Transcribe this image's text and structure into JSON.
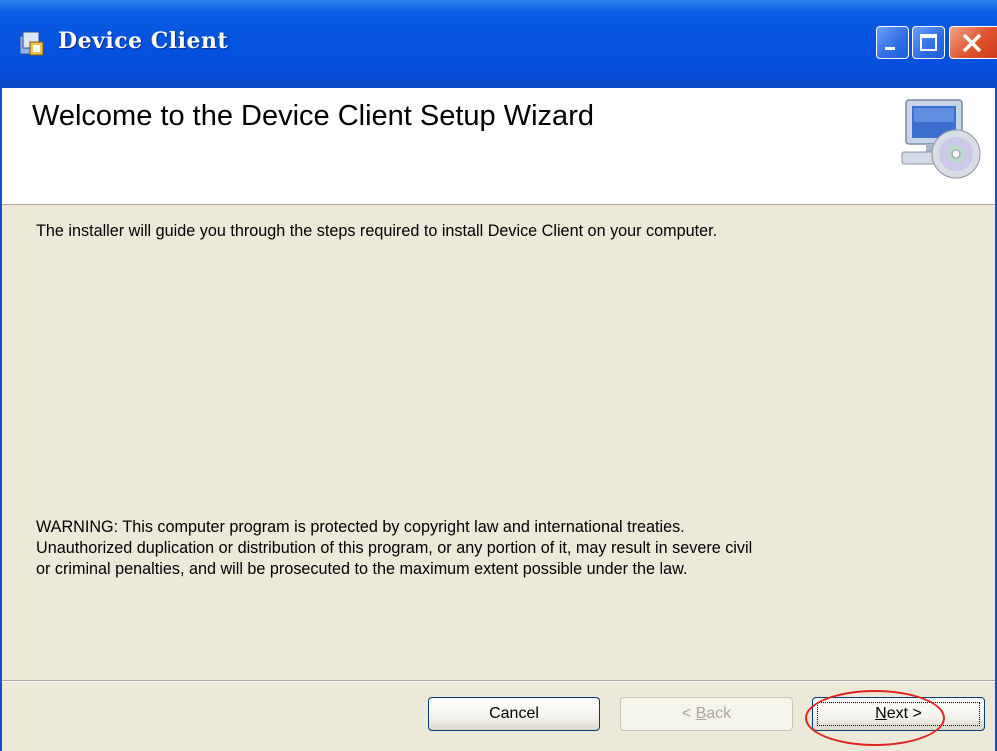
{
  "window": {
    "title": "Device Client",
    "controls": {
      "minimize": "minimize-icon",
      "maximize": "maximize-icon",
      "close": "close-icon"
    }
  },
  "header": {
    "title": "Welcome to the Device Client Setup Wizard",
    "icon": "computer-cd-icon"
  },
  "content": {
    "intro": "The installer will guide you through the steps required to install Device Client on your computer.",
    "warning_lines": [
      "WARNING: This computer program is protected by copyright law and international treaties.",
      "Unauthorized duplication or distribution of this program, or any portion of it, may result in severe civil",
      "or criminal penalties, and will be prosecuted to the maximum extent possible under the law."
    ]
  },
  "buttons": {
    "cancel": "Cancel",
    "back_prefix": "< ",
    "back_accel": "B",
    "back_rest": "ack",
    "next_accel": "N",
    "next_rest": "ext >"
  },
  "colors": {
    "titlebar": "#0453df",
    "dialog_bg": "#ece9d8",
    "highlight": "#e0231e"
  }
}
